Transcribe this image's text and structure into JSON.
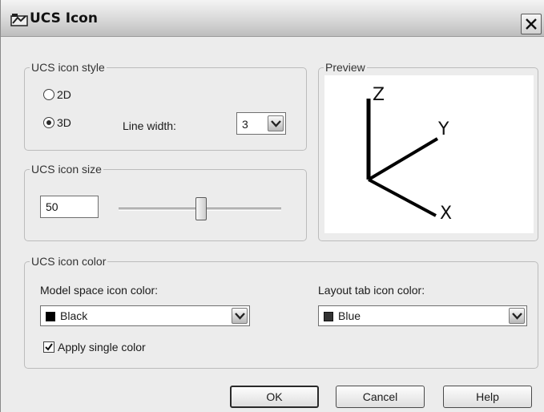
{
  "window": {
    "title": "UCS Icon",
    "icon": "ucs-window-icon",
    "close_icon": "close-icon"
  },
  "style_group": {
    "legend": "UCS icon style",
    "radio_2d_label": "2D",
    "radio_3d_label": "3D",
    "selected": "3D",
    "line_width_label": "Line width:",
    "line_width_value": "3"
  },
  "size_group": {
    "legend": "UCS icon size",
    "value": "50",
    "slider_position_fraction": 0.5
  },
  "preview_group": {
    "legend": "Preview",
    "axis_x": "X",
    "axis_y": "Y",
    "axis_z": "Z"
  },
  "color_group": {
    "legend": "UCS icon color",
    "model_label": "Model space icon color:",
    "model_value": "Black",
    "model_swatch": "#000000",
    "layout_label": "Layout tab icon color:",
    "layout_value": "Blue",
    "layout_swatch": "#333333",
    "apply_single_label": "Apply single color",
    "apply_single_checked": true
  },
  "buttons": {
    "ok": "OK",
    "cancel": "Cancel",
    "help": "Help"
  }
}
